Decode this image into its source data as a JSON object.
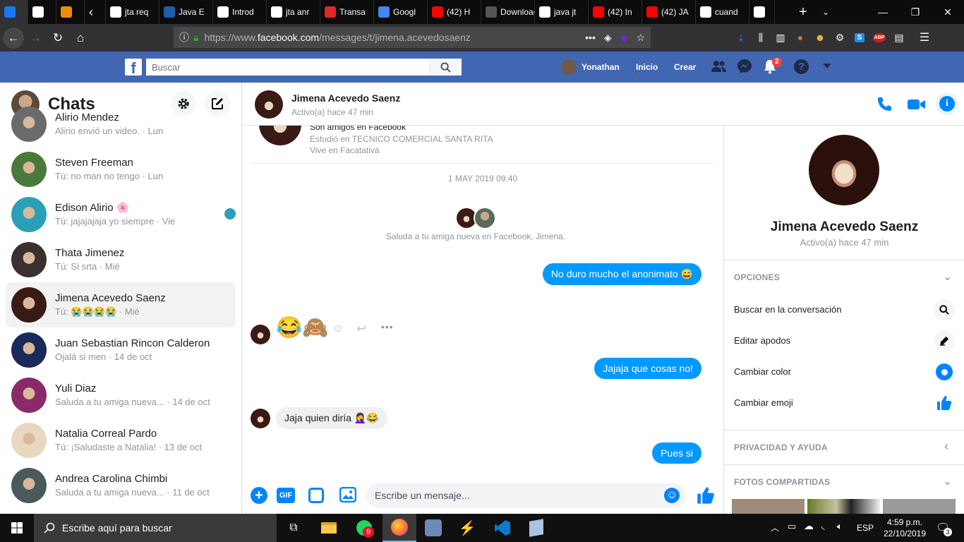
{
  "tabs": [
    {
      "title": "",
      "favicon": "facebook-icon",
      "color": "#1877f2",
      "active": true
    },
    {
      "title": "",
      "favicon": "globe-icon",
      "color": "#ffffff"
    },
    {
      "title": "",
      "favicon": "vlc-cone-icon",
      "color": "#f08c00"
    },
    {
      "title": "jta req",
      "favicon": "google-icon",
      "color": "#ffffff"
    },
    {
      "title": "Java E",
      "favicon": "bl-icon",
      "color": "#1b5fa6"
    },
    {
      "title": "Introd",
      "favicon": "doc-icon",
      "color": "#ffffff"
    },
    {
      "title": "jta anr",
      "favicon": "google-icon",
      "color": "#ffffff"
    },
    {
      "title": "Transa",
      "favicon": "oracle-icon",
      "color": "#e4262a"
    },
    {
      "title": "Googl",
      "favicon": "translate-icon",
      "color": "#4285f4"
    },
    {
      "title": "(42) H",
      "favicon": "youtube-icon",
      "color": "#ff0000"
    },
    {
      "title": "Download",
      "favicon": "download-page-icon",
      "color": "#555555"
    },
    {
      "title": "java jt",
      "favicon": "google-icon",
      "color": "#ffffff"
    },
    {
      "title": "(42) In",
      "favicon": "youtube-icon",
      "color": "#ff0000"
    },
    {
      "title": "(42) JA",
      "favicon": "youtube-icon",
      "color": "#ff0000"
    },
    {
      "title": "cuand",
      "favicon": "google-icon",
      "color": "#ffffff"
    },
    {
      "title": "",
      "favicon": "google-icon",
      "color": "#ffffff"
    }
  ],
  "browser": {
    "url_prefix": "https://www.",
    "url_host": "facebook.com",
    "url_path": "/messages/t/jimena.acevedosaenz"
  },
  "fb": {
    "logo": "f",
    "search_placeholder": "Buscar",
    "user_name": "Yonathan",
    "home": "Inicio",
    "create": "Crear",
    "notif_count": "2"
  },
  "sidebar": {
    "title": "Chats",
    "conversations": [
      {
        "name": "Alirio Mendez",
        "preview": "Alirio envió un video. · Lun",
        "avatar_color": "#6b6b6b"
      },
      {
        "name": "Steven Freeman",
        "preview": "Tú: no man no tengo · Lun",
        "avatar_color": "#4a7a3a"
      },
      {
        "name": "Edison Alirio 🌸",
        "preview": "Tú: jajajajaja yo siempre · Vie",
        "avatar_color": "#2aa0b8"
      },
      {
        "name": "Thata Jimenez",
        "preview": "Tú: Si srta · Mié",
        "avatar_color": "#3a3030"
      },
      {
        "name": "Jimena Acevedo Saenz",
        "preview": "Tú: 😭😭😭😭 · Mié",
        "avatar_color": "#3a1a14",
        "selected": true
      },
      {
        "name": "Juan Sebastian Rincon Calderon",
        "preview": "Ojalá si men · 14 de oct",
        "avatar_color": "#1a2a5a"
      },
      {
        "name": "Yuli Diaz",
        "preview": "Saluda a tu amiga nueva... · 14 de oct",
        "avatar_color": "#8a2a6a"
      },
      {
        "name": "Natalia Correal Pardo",
        "preview": "Tú: ¡Saludaste a Natalia! · 13 de oct",
        "avatar_color": "#e8d8c0"
      },
      {
        "name": "Andrea Carolina Chimbi",
        "preview": "Saluda a tu amiga nueva... · 11 de oct",
        "avatar_color": "#4a5a5a"
      }
    ]
  },
  "header": {
    "name": "Jimena Acevedo Saenz",
    "status": "Activo(a) hace 47 min"
  },
  "thread": {
    "intro_friends": "Son amigos en Facebook",
    "intro_study": "Estudió en TECNICO COMERCIAL SANTA RITA",
    "intro_lives": "Vive en Facatativá",
    "date": "1 MAY 2019 09:40",
    "greet": "Saluda a tu amiga nueva en Facebook, Jimena.",
    "m1": "No duro mucho el anonimato 😅",
    "m2_emojis": "😂🙈",
    "m3": "Jajaja que cosas no!",
    "m4": "Jaja quien diría 🤦‍♀️😂",
    "m5": "Pues si"
  },
  "composer": {
    "gif": "GIF",
    "placeholder": "Escribe un mensaje..."
  },
  "info": {
    "name": "Jimena Acevedo Saenz",
    "status": "Activo(a) hace 47 min",
    "options_header": "OPCIONES",
    "opt_search": "Buscar en la conversación",
    "opt_nick": "Editar apodos",
    "opt_color": "Cambiar color",
    "opt_emoji": "Cambiar emoji",
    "privacy_header": "PRIVACIDAD Y AYUDA",
    "photos_header": "FOTOS COMPARTIDAS"
  },
  "taskbar": {
    "search_placeholder": "Escribe aquí para buscar",
    "whatsapp_badge": "9",
    "lang": "ESP",
    "time": "4:59 p.m.",
    "date": "22/10/2019",
    "notif_count": "3"
  },
  "colors": {
    "fb_blue": "#4267b2",
    "messenger_blue": "#0099ff",
    "accent": "#0084ff"
  }
}
